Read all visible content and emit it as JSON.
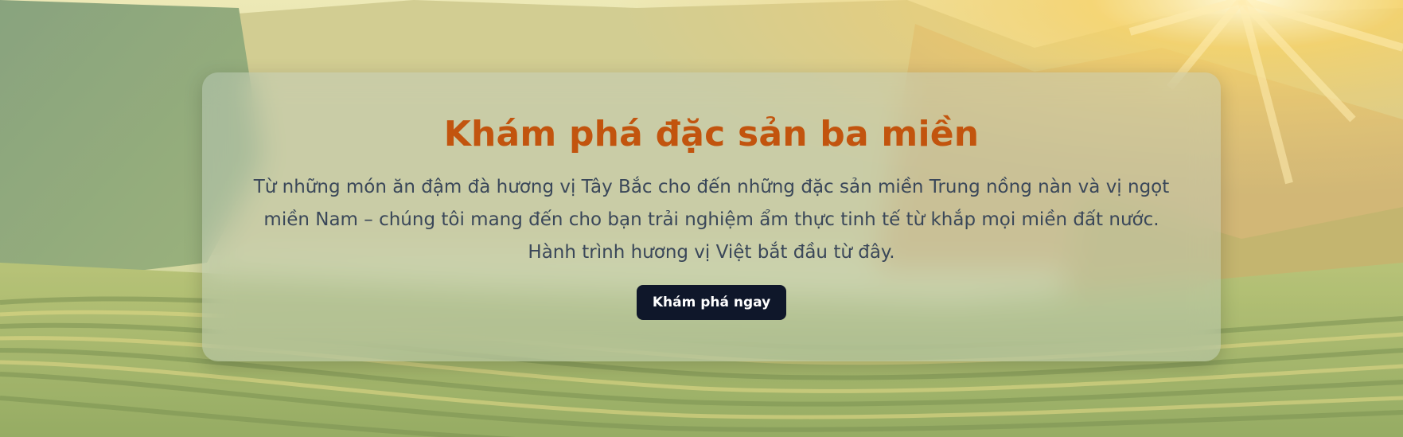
{
  "hero": {
    "background_icon": "terraced-rice-field-image",
    "title": "Khám phá đặc sản ba miền",
    "description": "Từ những món ăn đậm đà hương vị Tây Bắc cho đến những đặc sản miền Trung nồng nàn và vị ngọt miền Nam – chúng tôi mang đến cho bạn trải nghiệm ẩm thực tinh tế từ khắp mọi miền đất nước. Hành trình hương vị Việt bắt đầu từ đây.",
    "cta_label": "Khám phá ngay",
    "colors": {
      "title": "#c2540e",
      "description": "#3a4759",
      "cta_background": "#0f172a",
      "cta_text": "#ffffff"
    }
  }
}
